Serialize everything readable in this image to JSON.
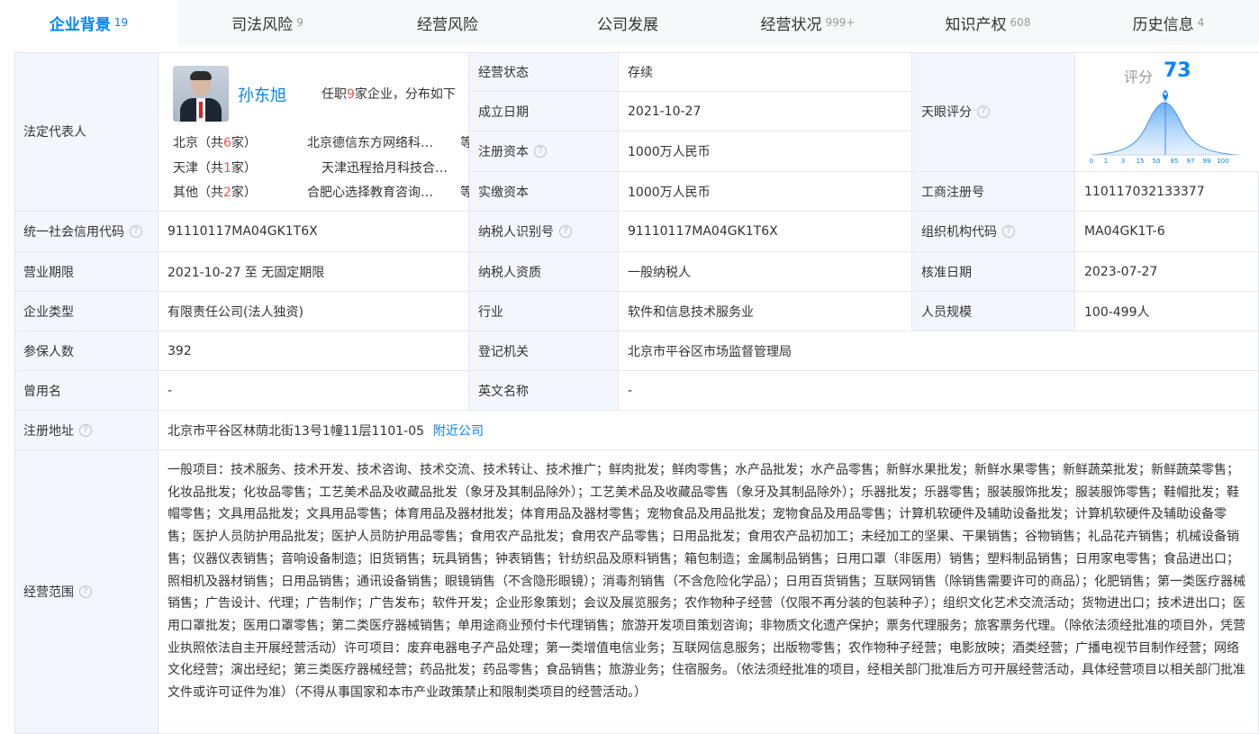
{
  "tabs": [
    {
      "label": "企业背景",
      "count": "19"
    },
    {
      "label": "司法风险",
      "count": "9"
    },
    {
      "label": "经营风险",
      "count": ""
    },
    {
      "label": "公司发展",
      "count": ""
    },
    {
      "label": "经营状况",
      "count": "999+"
    },
    {
      "label": "知识产权",
      "count": "608"
    },
    {
      "label": "历史信息",
      "count": "4"
    }
  ],
  "legal_rep": {
    "label": "法定代表人",
    "name": "孙东旭",
    "summary_prefix": "任职",
    "summary_count": "9",
    "summary_suffix": "家企业，分布如下",
    "regions": [
      {
        "loc_prefix": "北京（共",
        "count": "6",
        "loc_suffix": "家）",
        "company": "北京德信东方网络科…",
        "more": "等"
      },
      {
        "loc_prefix": "天津（共",
        "count": "1",
        "loc_suffix": "家）",
        "company": "天津迅程拾月科技合…",
        "more": ""
      },
      {
        "loc_prefix": "其他（共",
        "count": "2",
        "loc_suffix": "家）",
        "company": "合肥心选择教育咨询…",
        "more": "等"
      }
    ]
  },
  "fields": {
    "status_label": "经营状态",
    "status": "存续",
    "founded_label": "成立日期",
    "founded": "2021-10-27",
    "reg_capital_label": "注册资本",
    "reg_capital": "1000万人民币",
    "paid_capital_label": "实缴资本",
    "paid_capital": "1000万人民币",
    "tianyan_label": "天眼评分",
    "biz_reg_label": "工商注册号",
    "biz_reg": "110117032133377",
    "credit_code_label": "统一社会信用代码",
    "credit_code": "91110117MA04GK1T6X",
    "taxpayer_id_label": "纳税人识别号",
    "taxpayer_id": "91110117MA04GK1T6X",
    "org_code_label": "组织机构代码",
    "org_code": "MA04GK1T-6",
    "term_label": "营业期限",
    "term": "2021-10-27 至 无固定期限",
    "taxpayer_qual_label": "纳税人资质",
    "taxpayer_qual": "一般纳税人",
    "approve_date_label": "核准日期",
    "approve_date": "2023-07-27",
    "type_label": "企业类型",
    "type": "有限责任公司(法人独资)",
    "industry_label": "行业",
    "industry": "软件和信息技术服务业",
    "staff_label": "人员规模",
    "staff": "100-499人",
    "insured_label": "参保人数",
    "insured": "392",
    "authority_label": "登记机关",
    "authority": "北京市平谷区市场监督管理局",
    "former_name_label": "曾用名",
    "former_name": "-",
    "english_name_label": "英文名称",
    "english_name": "-",
    "address_label": "注册地址",
    "address": "北京市平谷区林荫北街13号1幢11层1101-05",
    "nearby_link": "附近公司",
    "scope_label": "经营范围",
    "scope": "一般项目：技术服务、技术开发、技术咨询、技术交流、技术转让、技术推广；鲜肉批发；鲜肉零售；水产品批发；水产品零售；新鲜水果批发；新鲜水果零售；新鲜蔬菜批发；新鲜蔬菜零售；化妆品批发；化妆品零售；工艺美术品及收藏品批发（象牙及其制品除外）；工艺美术品及收藏品零售（象牙及其制品除外）；乐器批发；乐器零售；服装服饰批发；服装服饰零售；鞋帽批发；鞋帽零售；文具用品批发；文具用品零售；体育用品及器材批发；体育用品及器材零售；宠物食品及用品批发；宠物食品及用品零售；计算机软硬件及辅助设备批发；计算机软硬件及辅助设备零售；医护人员防护用品批发；医护人员防护用品零售；食用农产品批发；食用农产品零售；日用品批发；食用农产品初加工；未经加工的坚果、干果销售；谷物销售；礼品花卉销售；机械设备销售；仪器仪表销售；音响设备制造；旧货销售；玩具销售；钟表销售；针纺织品及原料销售；箱包制造；金属制品销售；日用口罩（非医用）销售；塑料制品销售；日用家电零售；食品进出口；照相机及器材销售；日用品销售；通讯设备销售；眼镜销售（不含隐形眼镜）；消毒剂销售（不含危险化学品）；日用百货销售；互联网销售（除销售需要许可的商品）；化肥销售；第一类医疗器械销售；广告设计、代理；广告制作；广告发布；软件开发；企业形象策划；会议及展览服务；农作物种子经营（仅限不再分装的包装种子）；组织文化艺术交流活动；货物进出口；技术进出口；医用口罩批发；医用口罩零售；第二类医疗器械销售；单用途商业预付卡代理销售；旅游开发项目策划咨询；非物质文化遗产保护；票务代理服务；旅客票务代理。（除依法须经批准的项目外，凭营业执照依法自主开展经营活动）许可项目：废弃电器电子产品处理；第一类增值电信业务；互联网信息服务；出版物零售；农作物种子经营；电影放映；酒类经营；广播电视节目制作经营；网络文化经营；演出经纪；第三类医疗器械经营；药品批发；药品零售；食品销售；旅游业务；住宿服务。（依法须经批准的项目，经相关部门批准后方可开展经营活动，具体经营项目以相关部门批准文件或许可证件为准）（不得从事国家和本市产业政策禁止和限制类项目的经营活动。）"
  },
  "score": {
    "label": "评分",
    "value": "73",
    "axis_ticks": [
      "0",
      "1",
      "3",
      "15",
      "50",
      "85",
      "97",
      "99",
      "100"
    ]
  },
  "colors": {
    "accent": "#0084ff",
    "label_bg": "#f3f7fd",
    "border": "#e4e7ed",
    "highlight": "#ff4d4f"
  }
}
